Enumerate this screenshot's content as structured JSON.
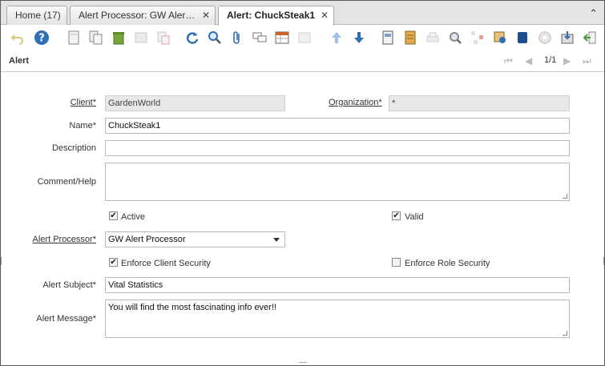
{
  "tabs": [
    {
      "label": "Home (17)",
      "closable": false
    },
    {
      "label": "Alert Processor: GW Alert P...",
      "closable": true
    },
    {
      "label": "Alert: ChuckSteak1",
      "closable": true
    }
  ],
  "tab_close_glyph": "✕",
  "collapse_glyph": "⌃",
  "toolbar_icons": [
    "undo-icon",
    "help-icon",
    "new-record-icon",
    "copy-record-icon",
    "delete-icon",
    "save-icon",
    "delete-selection-icon",
    "refresh-icon",
    "find-icon",
    "attachment-icon",
    "chat-icon",
    "grid-toggle-icon",
    "history-icon",
    "parent-record-icon",
    "detail-record-icon",
    "report-icon",
    "archived-docs-icon",
    "print-icon",
    "zoom-across-icon",
    "workflow-icon",
    "request-icon",
    "product-info-icon",
    "active-workflows-icon",
    "export-icon",
    "exit-icon"
  ],
  "window": {
    "title": "Alert",
    "pager": "1/1"
  },
  "form": {
    "client": {
      "label": "Client",
      "value": "GardenWorld"
    },
    "organization": {
      "label": "Organization",
      "value": "*"
    },
    "name": {
      "label": "Name",
      "value": "ChuckSteak1"
    },
    "description": {
      "label": "Description",
      "value": ""
    },
    "comment_help": {
      "label": "Comment/Help",
      "value": ""
    },
    "active": {
      "label": "Active",
      "checked": true
    },
    "valid": {
      "label": "Valid",
      "checked": true
    },
    "alert_processor": {
      "label": "Alert Processor",
      "value": "GW Alert Processor"
    },
    "enforce_client_security": {
      "label": "Enforce Client Security",
      "checked": true
    },
    "enforce_role_security": {
      "label": "Enforce Role Security",
      "checked": false
    },
    "alert_subject": {
      "label": "Alert Subject",
      "value": "Vital Statistics"
    },
    "alert_message": {
      "label": "Alert Message",
      "value": "You will find the most fascinating info ever!!"
    }
  },
  "mandatory_mark": "*",
  "check_glyph": "✔",
  "colors": {
    "accent_blue": "#2f6fb5",
    "readonly_bg": "#e8e8e8",
    "tab_bar": "#e4e4e4"
  }
}
